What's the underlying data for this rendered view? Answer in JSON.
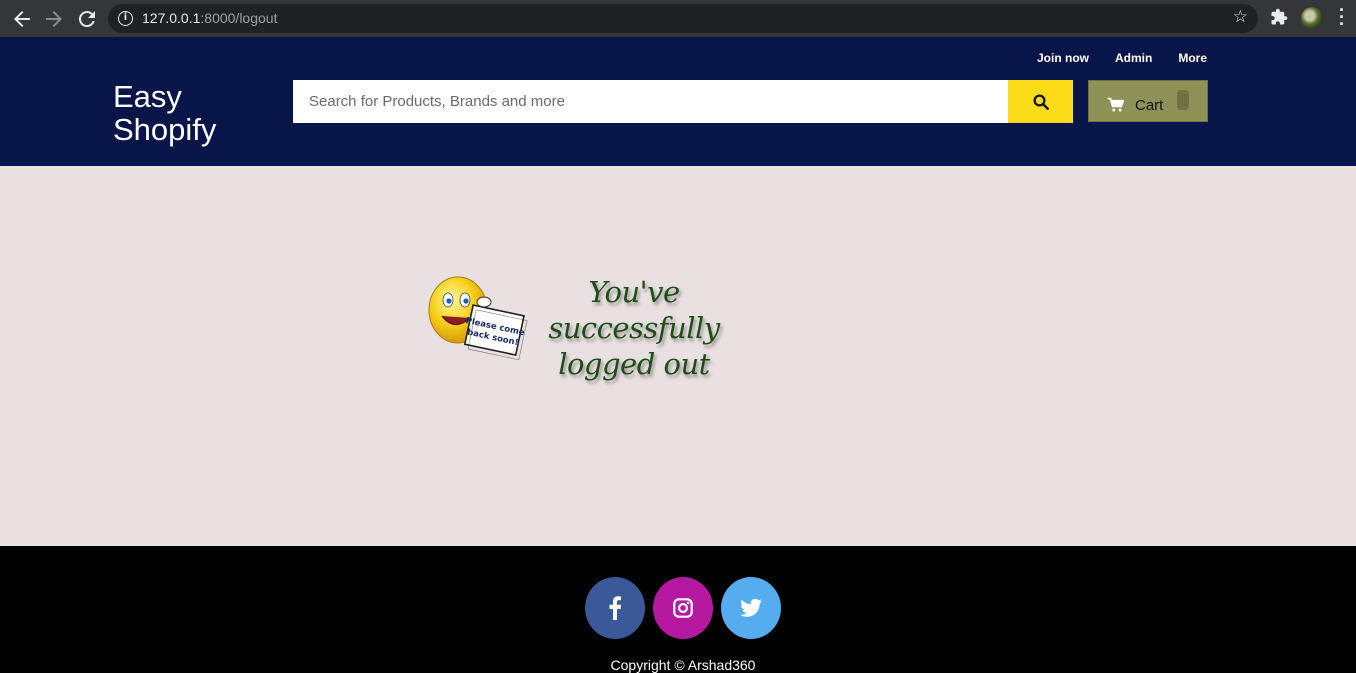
{
  "browser": {
    "url_host": "127.0.0.1",
    "url_rest": ":8000/logout",
    "icons": [
      "back-icon",
      "forward-icon",
      "reload-icon",
      "info-icon",
      "star-icon",
      "extensions-icon",
      "profile-avatar",
      "menu-icon"
    ]
  },
  "header": {
    "brand_line1": "Easy",
    "brand_line2": "Shopify",
    "links": [
      "Join now",
      "Admin",
      "More"
    ],
    "search_placeholder": "Search for Products, Brands and more",
    "cart_label": "Cart",
    "colors": {
      "background": "#081548",
      "search_button": "#fcdc17",
      "cart_button": "#8f9256"
    }
  },
  "main": {
    "message_line1": "You've successfully",
    "message_line2": "logged out",
    "sign_text": "Please come back soon!",
    "background": "#e8e0e1"
  },
  "footer": {
    "socials": [
      {
        "name": "facebook",
        "color": "#3b5998"
      },
      {
        "name": "instagram",
        "color": "#b5199f"
      },
      {
        "name": "twitter",
        "color": "#55acee"
      }
    ],
    "copyright": "Copyright © Arshad360"
  }
}
